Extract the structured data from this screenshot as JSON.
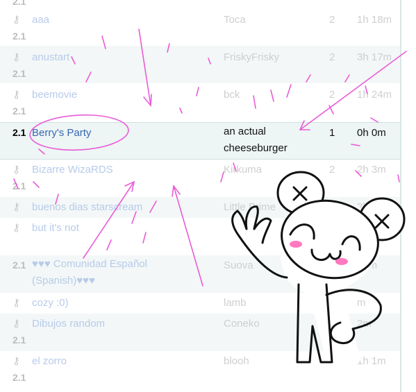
{
  "rows": [
    {
      "version": "2.1",
      "name": "aaa",
      "owner": "Toca",
      "players": "2",
      "time": "1h 18m"
    },
    {
      "version": "2.1",
      "name": "anustart",
      "owner": "FriskyFrisky",
      "players": "2",
      "time": "3h 17m"
    },
    {
      "version": "2.1",
      "name": "beemovie",
      "owner": "bck",
      "players": "2",
      "time": "1h 24m"
    },
    {
      "version": "2.1",
      "name": "Berry's Party",
      "owner_line1": "an actual",
      "owner_line2": "cheeseburger",
      "players": "1",
      "time": "0h 0m"
    },
    {
      "version": "2.1",
      "name": "Bizarre WizaRDS",
      "owner": "Kirkuma",
      "players": "2",
      "time": "2h 3m"
    },
    {
      "version": "2.1",
      "name": "buenos dias starscream",
      "owner": "Little Prime",
      "players": "2",
      "time": "2h"
    },
    {
      "version": "2.1",
      "name": "but it's not",
      "owner": "",
      "players": "",
      "time": ""
    },
    {
      "version": "2.1",
      "name_line1": "♥♥♥ Comunidad Español",
      "name_line2": "(Spanish)♥♥♥",
      "owner": "Suova",
      "players": "",
      "time": "54m"
    },
    {
      "version": "2.1",
      "name": "cozy :0)",
      "owner": "lamb",
      "players": "",
      "time": "m"
    },
    {
      "version": "2.1",
      "name": "Dibujos random",
      "owner": "Coneko",
      "players": "",
      "time": "2m"
    },
    {
      "version": "2.1",
      "name": "el zorro",
      "owner": "blooh",
      "players": "",
      "time": "1h 1m"
    }
  ],
  "icons": {
    "key": "key-icon"
  },
  "colors": {
    "accent_name": "#3567b3",
    "faded_name": "#b7cbe9",
    "doodle_pink": "#e95bd8"
  }
}
